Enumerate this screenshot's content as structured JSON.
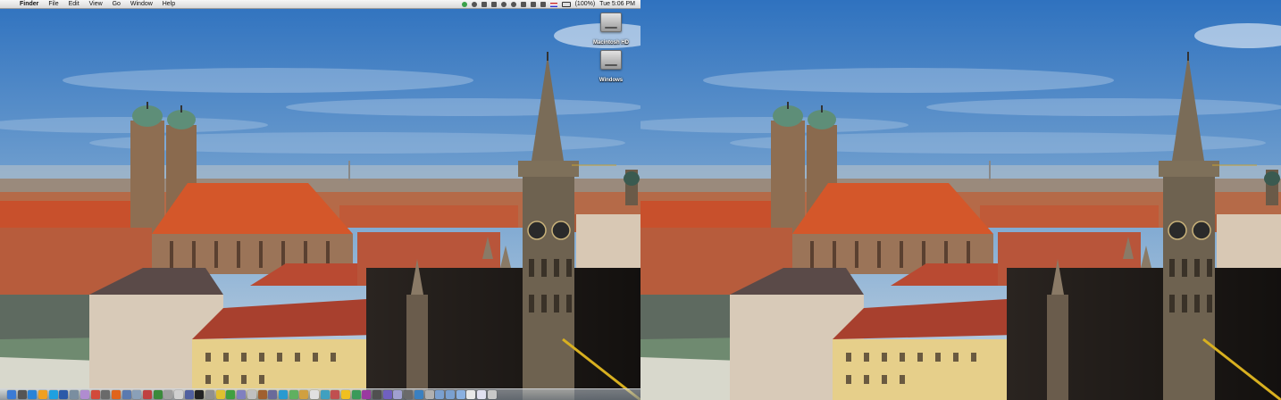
{
  "menubar": {
    "apple_glyph": "",
    "app_name": "Finder",
    "menus": [
      "File",
      "Edit",
      "View",
      "Go",
      "Window",
      "Help"
    ],
    "battery": "(100%)",
    "clock": "Tue 5:06 PM"
  },
  "desktop": {
    "icons": [
      {
        "label": "Macintosh HD"
      },
      {
        "label": "Windows"
      }
    ]
  },
  "dock": {
    "items": [
      {
        "icon": "finder-icon",
        "color": "#3a7bd5"
      },
      {
        "icon": "dashboard-icon",
        "color": "#555555"
      },
      {
        "icon": "safari-icon",
        "color": "#2a83d8"
      },
      {
        "icon": "ichat-icon",
        "color": "#f0a020"
      },
      {
        "icon": "skype-icon",
        "color": "#1ea0e0"
      },
      {
        "icon": "word-icon",
        "color": "#2b5aa8"
      },
      {
        "icon": "app-icon",
        "color": "#7a8ea0"
      },
      {
        "icon": "app-icon",
        "color": "#b08cd0"
      },
      {
        "icon": "app-icon",
        "color": "#d24a3a"
      },
      {
        "icon": "app-icon",
        "color": "#6a6a6a"
      },
      {
        "icon": "firefox-icon",
        "color": "#e0641c"
      },
      {
        "icon": "app-icon",
        "color": "#5a7ab0"
      },
      {
        "icon": "app-icon",
        "color": "#8aa0b8"
      },
      {
        "icon": "app-icon",
        "color": "#c04040"
      },
      {
        "icon": "app-icon",
        "color": "#3a8a3a"
      },
      {
        "icon": "app-icon",
        "color": "#a0a0a0"
      },
      {
        "icon": "app-icon",
        "color": "#d0d0d0"
      },
      {
        "icon": "app-icon",
        "color": "#5060a0"
      },
      {
        "icon": "terminal-icon",
        "color": "#222222"
      },
      {
        "icon": "app-icon",
        "color": "#909090"
      },
      {
        "icon": "app-icon",
        "color": "#e0c030"
      },
      {
        "icon": "app-icon",
        "color": "#40a040"
      },
      {
        "icon": "app-icon",
        "color": "#8080c0"
      },
      {
        "icon": "app-icon",
        "color": "#c0c0c0"
      },
      {
        "icon": "app-icon",
        "color": "#a06030"
      },
      {
        "icon": "app-icon",
        "color": "#6a6a9a"
      },
      {
        "icon": "app-icon",
        "color": "#2a9ad0"
      },
      {
        "icon": "app-icon",
        "color": "#60b060"
      },
      {
        "icon": "app-icon",
        "color": "#d0a040"
      },
      {
        "icon": "app-icon",
        "color": "#e0e0e0"
      },
      {
        "icon": "app-icon",
        "color": "#40a0c0"
      },
      {
        "icon": "app-icon",
        "color": "#c05050"
      },
      {
        "icon": "app-icon",
        "color": "#f0c020"
      },
      {
        "icon": "app-icon",
        "color": "#3a9a5a"
      },
      {
        "icon": "app-icon",
        "color": "#9a3aa0"
      },
      {
        "icon": "app-icon",
        "color": "#505050"
      },
      {
        "icon": "app-icon",
        "color": "#7060c0"
      },
      {
        "icon": "app-icon",
        "color": "#a0a0d0"
      },
      {
        "icon": "app-icon",
        "color": "#6a6a6a"
      },
      {
        "icon": "app-icon",
        "color": "#3a80c0"
      },
      {
        "icon": "app-icon",
        "color": "#b0b0b0"
      },
      {
        "icon": "folder-icon",
        "color": "#7aa0d0"
      },
      {
        "icon": "folder-icon",
        "color": "#7aa0d0"
      },
      {
        "icon": "folder-icon",
        "color": "#8ab0e0"
      },
      {
        "icon": "document-icon",
        "color": "#e8e8e8"
      },
      {
        "icon": "document-icon",
        "color": "#e0e0f0"
      },
      {
        "icon": "trash-icon",
        "color": "#c8c8c8"
      }
    ]
  },
  "colors": {
    "sky_top": "#2f72bf",
    "sky_horizon": "#c4d6e4",
    "roof_red": "#c8502c",
    "menubar_bg": "#e8e8e8"
  }
}
